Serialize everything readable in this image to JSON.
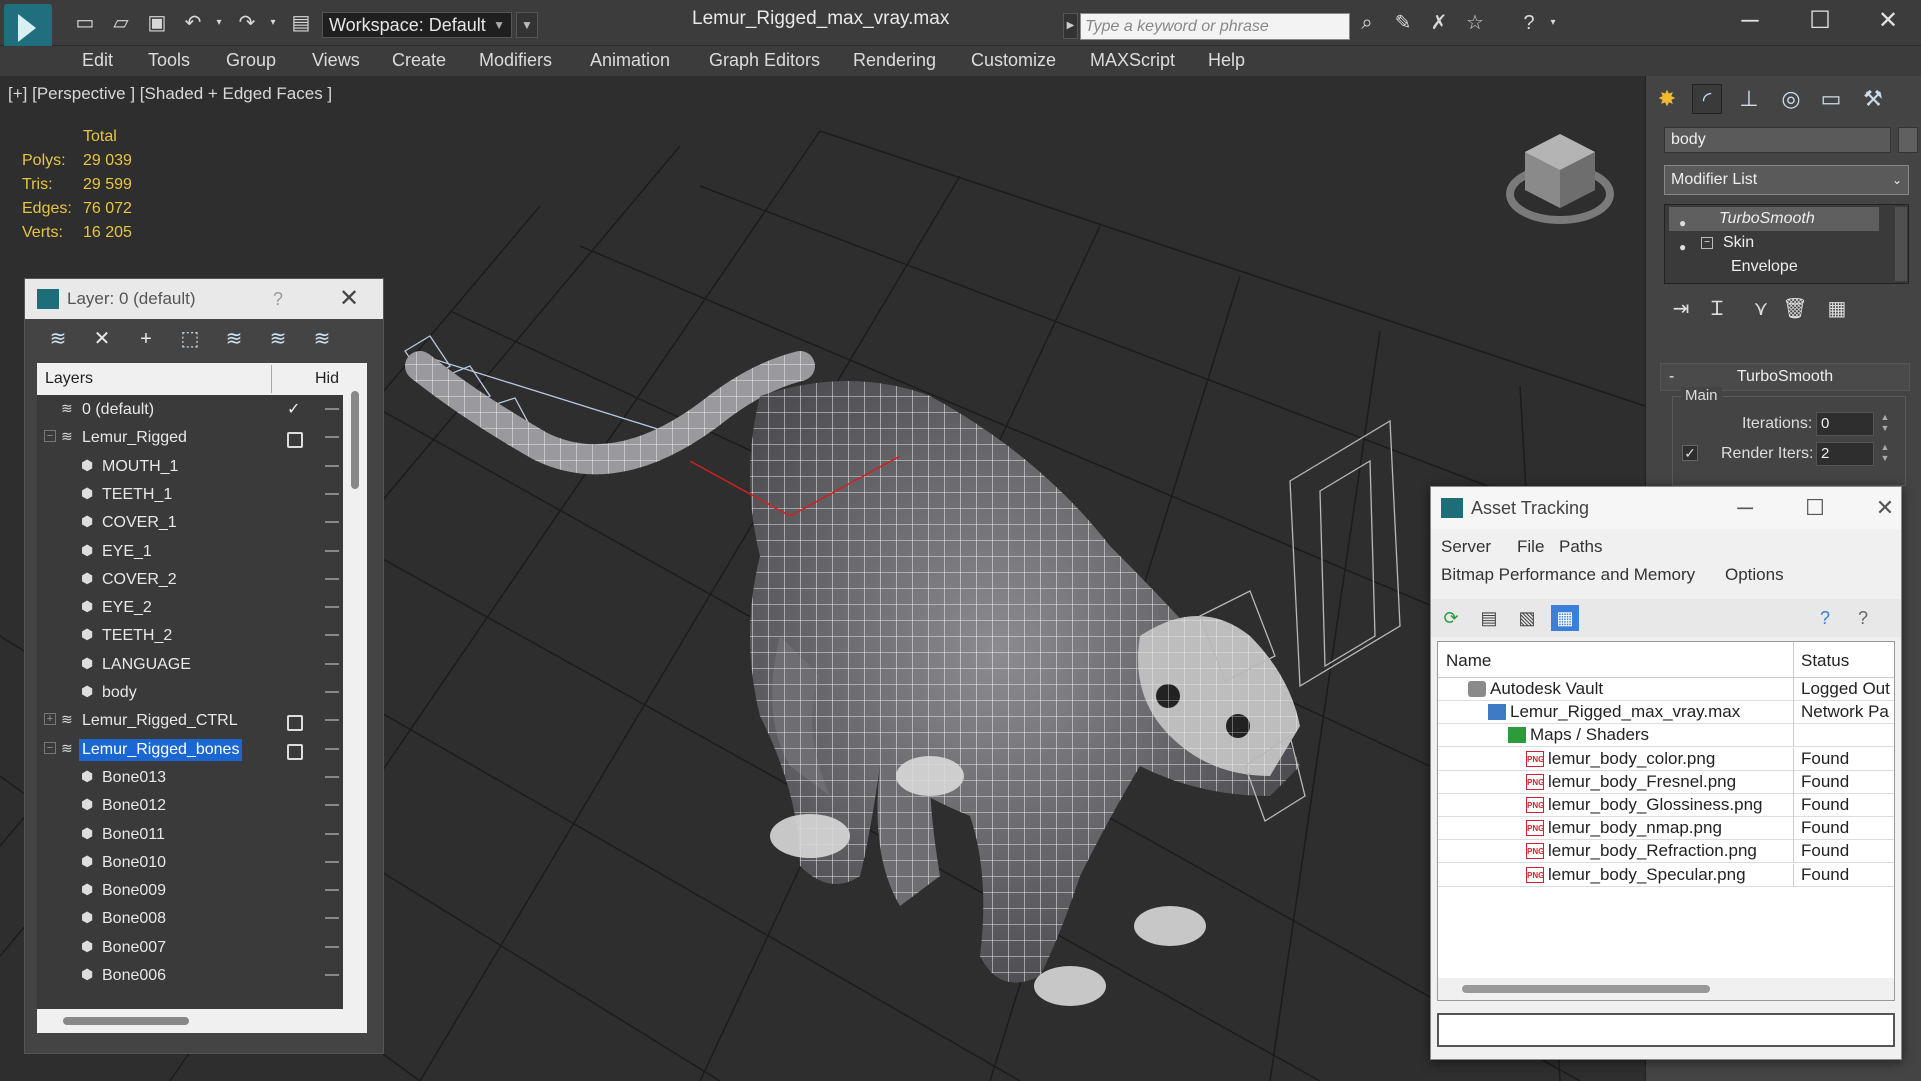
{
  "app": {
    "document_title": "Lemur_Rigged_max_vray.max",
    "workspace": "Workspace: Default",
    "search_placeholder": "Type a keyword or phrase"
  },
  "menu": [
    "Edit",
    "Tools",
    "Group",
    "Views",
    "Create",
    "Modifiers",
    "Animation",
    "Graph Editors",
    "Rendering",
    "Customize",
    "MAXScript",
    "Help"
  ],
  "viewport": {
    "label": "[+] [Perspective ] [Shaded + Edged Faces ]",
    "stats": {
      "header": "Total",
      "rows": [
        {
          "key": "Polys:",
          "value": "29 039"
        },
        {
          "key": "Tris:",
          "value": "29 599"
        },
        {
          "key": "Edges:",
          "value": "76 072"
        },
        {
          "key": "Verts:",
          "value": "16 205"
        }
      ]
    }
  },
  "layer_window": {
    "title": "Layer: 0 (default)",
    "help": "?",
    "col_layers": "Layers",
    "col_hide": "Hid",
    "rows": [
      {
        "label": "0 (default)",
        "type": "layer"
      },
      {
        "label": "Lemur_Rigged",
        "type": "layer"
      },
      {
        "label": "MOUTH_1",
        "type": "object"
      },
      {
        "label": "TEETH_1",
        "type": "object"
      },
      {
        "label": "COVER_1",
        "type": "object"
      },
      {
        "label": "EYE_1",
        "type": "object"
      },
      {
        "label": "COVER_2",
        "type": "object"
      },
      {
        "label": "EYE_2",
        "type": "object"
      },
      {
        "label": "TEETH_2",
        "type": "object"
      },
      {
        "label": "LANGUAGE",
        "type": "object"
      },
      {
        "label": "body",
        "type": "object"
      },
      {
        "label": "Lemur_Rigged_CTRL",
        "type": "layer"
      },
      {
        "label": "Lemur_Rigged_bones",
        "type": "layer"
      },
      {
        "label": "Bone013",
        "type": "object"
      },
      {
        "label": "Bone012",
        "type": "object"
      },
      {
        "label": "Bone011",
        "type": "object"
      },
      {
        "label": "Bone010",
        "type": "object"
      },
      {
        "label": "Bone009",
        "type": "object"
      },
      {
        "label": "Bone008",
        "type": "object"
      },
      {
        "label": "Bone007",
        "type": "object"
      },
      {
        "label": "Bone006",
        "type": "object"
      }
    ]
  },
  "command_panel": {
    "object_name": "body",
    "modifier_list": "Modifier List",
    "stack": [
      "TurboSmooth",
      "Skin",
      "Envelope"
    ],
    "rollout": "TurboSmooth",
    "group_main": "Main",
    "iterations_label": "Iterations:",
    "iterations_value": "0",
    "render_iters_label": "Render Iters:",
    "render_iters_value": "2"
  },
  "asset_tracking": {
    "title": "Asset Tracking",
    "menu_row1": [
      "Server",
      "File",
      "Paths"
    ],
    "menu_row2": [
      "Bitmap Performance and Memory",
      "Options"
    ],
    "col_name": "Name",
    "col_status": "Status",
    "rows": [
      {
        "name": "Autodesk Vault",
        "status": "Logged Out",
        "icon": "vault"
      },
      {
        "name": "Lemur_Rigged_max_vray.max",
        "status": "Network Pa",
        "icon": "max"
      },
      {
        "name": "Maps / Shaders",
        "status": "",
        "icon": "maps"
      },
      {
        "name": "lemur_body_color.png",
        "status": "Found",
        "icon": "png"
      },
      {
        "name": "lemur_body_Fresnel.png",
        "status": "Found",
        "icon": "png"
      },
      {
        "name": "lemur_body_Glossiness.png",
        "status": "Found",
        "icon": "png"
      },
      {
        "name": "lemur_body_nmap.png",
        "status": "Found",
        "icon": "png"
      },
      {
        "name": "lemur_body_Refraction.png",
        "status": "Found",
        "icon": "png"
      },
      {
        "name": "lemur_body_Specular.png",
        "status": "Found",
        "icon": "png"
      }
    ]
  },
  "colors": {
    "stats_text": "#e6c640",
    "selection": "#1a66d2",
    "viewport_bg": "#2e2e2e"
  }
}
